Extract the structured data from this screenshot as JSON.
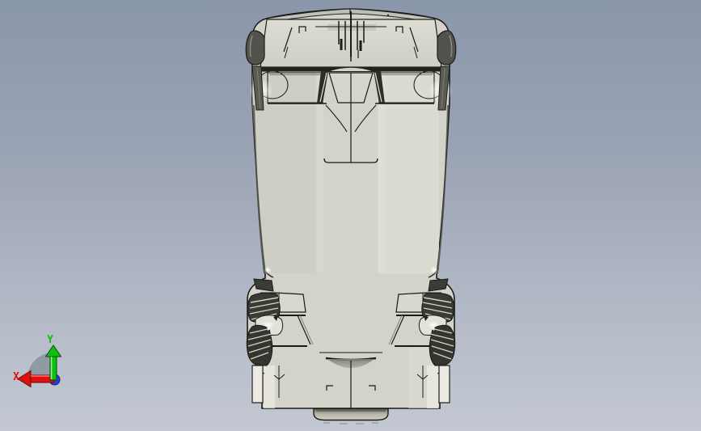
{
  "viewport": {
    "background_top": "#8a96aa",
    "background_bottom": "#c3c8d2",
    "model_name": "car-top-view",
    "body_color": "#d3d3c9",
    "edge_color": "#1b1b16"
  },
  "triad": {
    "x_label": "X",
    "y_label": "Y",
    "x_color": "#e01010",
    "y_color": "#10c010",
    "origin_color": "#2543d8"
  }
}
